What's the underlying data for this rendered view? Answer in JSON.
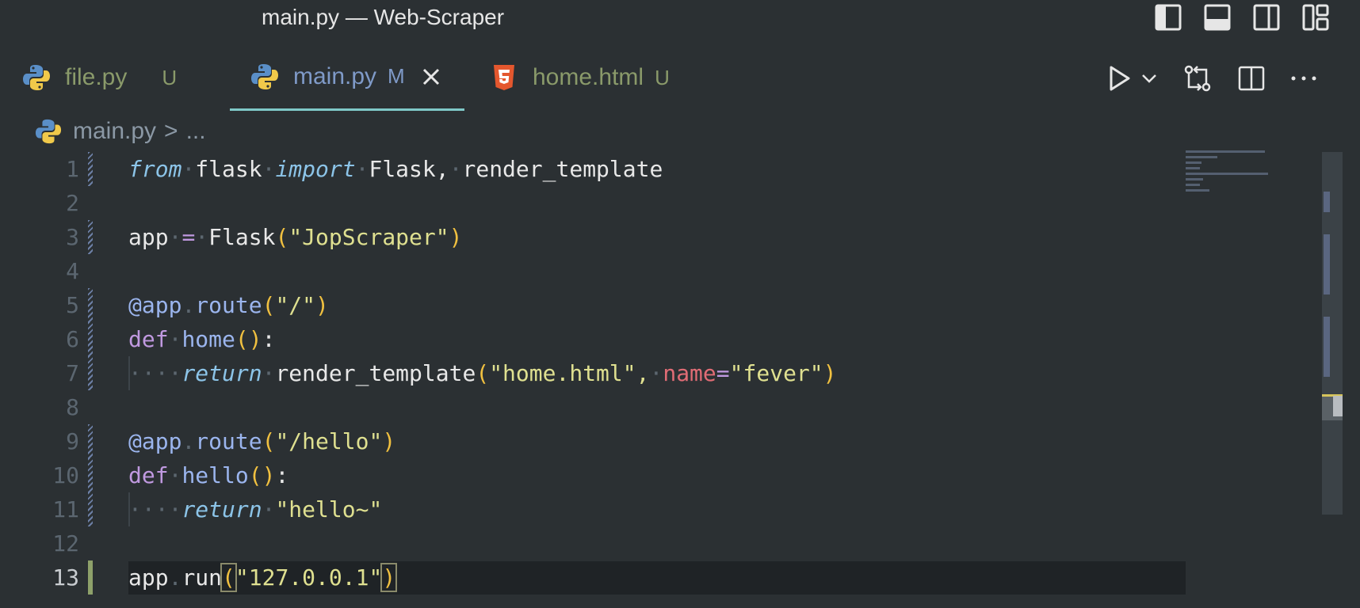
{
  "window": {
    "title": "main.py — Web-Scraper"
  },
  "tabs": [
    {
      "name": "file.py",
      "badge": "U",
      "icon": "python-icon"
    },
    {
      "name": "main.py",
      "badge": "M",
      "icon": "python-icon"
    },
    {
      "name": "home.html",
      "badge": "U",
      "icon": "html5-icon"
    }
  ],
  "breadcrumb": {
    "file": "main.py",
    "separator": ">",
    "rest": "..."
  },
  "code": {
    "line_numbers": [
      "1",
      "2",
      "3",
      "4",
      "5",
      "6",
      "7",
      "8",
      "9",
      "10",
      "11",
      "12",
      "13"
    ],
    "l1": {
      "from": "from",
      "module": "flask",
      "import": "import",
      "names": "Flask,",
      "name2": "render_template"
    },
    "l3": {
      "var": "app",
      "eq": "=",
      "cls": "Flask",
      "lp": "(",
      "arg": "\"JopScraper\"",
      "rp": ")"
    },
    "l5": {
      "dec": "@app",
      "dot": ".",
      "fn": "route",
      "lp": "(",
      "arg": "\"/\"",
      "rp": ")"
    },
    "l6": {
      "def": "def",
      "fn": "home",
      "parens": "()",
      "colon": ":"
    },
    "l7": {
      "ret": "return",
      "fn": "render_template",
      "lp": "(",
      "arg1": "\"home.html\",",
      "kw": "name",
      "eq": "=",
      "arg2": "\"fever\"",
      "rp": ")"
    },
    "l9": {
      "dec": "@app",
      "dot": ".",
      "fn": "route",
      "lp": "(",
      "arg": "\"/hello\"",
      "rp": ")"
    },
    "l10": {
      "def": "def",
      "fn": "hello",
      "parens": "()",
      "colon": ":"
    },
    "l11": {
      "ret": "return",
      "arg": "\"hello~\""
    },
    "l13": {
      "obj": "app",
      "dot": ".",
      "fn": "run",
      "lp": "(",
      "arg": "\"127.0.0.1\"",
      "rp": ")"
    }
  },
  "colors": {
    "background": "#2b3033",
    "active_tab_border": "#7fc8c8",
    "modified_badge": "#7f9ac8",
    "untracked_badge": "#8a9a6a"
  }
}
